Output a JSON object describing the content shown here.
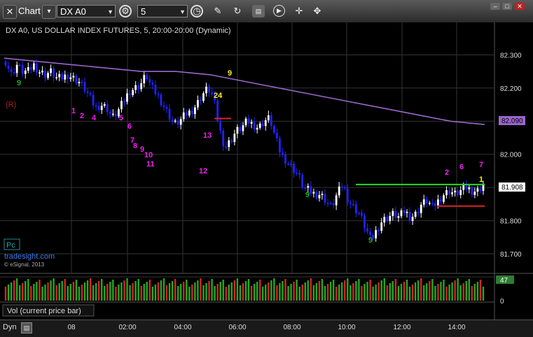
{
  "toolbar": {
    "chart_label": "Chart",
    "symbol": "DX A0",
    "interval": "5",
    "icons": [
      "pin-icon",
      "chart-icon",
      "dropdown-icon",
      "settings-icon",
      "clock-icon",
      "draw-icon",
      "refresh-icon",
      "study-icon",
      "play-icon",
      "move-icon"
    ]
  },
  "chart": {
    "title": "DX A0, US DOLLAR INDEX FUTURES, 5, 20:00-20:00 (Dynamic)",
    "r_marker": "(R)",
    "watermark_box": "Pc",
    "watermark_site": "tradesight.com",
    "watermark_copy": "© eSignal, 2013",
    "price_ticks": [
      "82.300",
      "82.200",
      "82.100",
      "82.000",
      "81.900",
      "81.800",
      "81.700"
    ],
    "ma_last_label": "82.090",
    "last_price_label": "81.908",
    "time_ticks": [
      "08",
      "02:00",
      "04:00",
      "06:00",
      "08:00",
      "10:00",
      "12:00",
      "14:00"
    ],
    "volume_label": "Vol (current price bar)",
    "volume_value": "47",
    "volume_zero": "0",
    "bottom_label": "Dyn"
  },
  "chart_data": {
    "type": "candlestick",
    "title": "DX A0, US DOLLAR INDEX FUTURES, 5, 20:00-20:00 (Dynamic)",
    "y_range": [
      81.66,
      82.36
    ],
    "y_ticks": [
      82.3,
      82.2,
      82.1,
      82.0,
      81.9,
      81.8,
      81.7
    ],
    "x_ticks": [
      "08",
      "02:00",
      "04:00",
      "06:00",
      "08:00",
      "10:00",
      "12:00",
      "14:00"
    ],
    "price_path": [
      82.28,
      82.24,
      82.27,
      82.25,
      82.25,
      82.27,
      82.25,
      82.24,
      82.25,
      82.23,
      82.23,
      82.24,
      82.23,
      82.22,
      82.2,
      82.17,
      82.14,
      82.15,
      82.14,
      82.11,
      82.13,
      82.16,
      82.19,
      82.2,
      82.21,
      82.24,
      82.2,
      82.18,
      82.15,
      82.12,
      82.09,
      82.1,
      82.12,
      82.13,
      82.15,
      82.18,
      82.2,
      82.17,
      82.08,
      82.02,
      82.04,
      82.07,
      82.08,
      82.1,
      82.09,
      82.08,
      82.1,
      82.11,
      82.05,
      82.0,
      81.98,
      81.96,
      81.94,
      81.9,
      81.89,
      81.88,
      81.88,
      81.86,
      81.84,
      81.88,
      81.91,
      81.86,
      81.84,
      81.82,
      81.78,
      81.74,
      81.77,
      81.8,
      81.81,
      81.82,
      81.81,
      81.83,
      81.81,
      81.82,
      81.85,
      81.86,
      81.84,
      81.86,
      81.88,
      81.89,
      81.88,
      81.89,
      81.9,
      81.89,
      81.89,
      81.91
    ],
    "ma_path": [
      82.29,
      82.28,
      82.27,
      82.26,
      82.25,
      82.25,
      82.24,
      82.22,
      82.2,
      82.18,
      82.16,
      82.14,
      82.12,
      82.1,
      82.09
    ],
    "support_lines": [
      {
        "value": 81.909,
        "color": "#22dd22"
      },
      {
        "value": 81.844,
        "color": "#dd2222"
      },
      {
        "value": 82.108,
        "color": "#dd2222"
      }
    ],
    "volume_last": 47,
    "colors": {
      "up_bar": "#ffffff",
      "down_bar": "#2222ff",
      "ma": "#9966cc",
      "grid": "#333333",
      "setup": "#ee22ee",
      "count": "#22aa22",
      "yellow": "#ffee22"
    },
    "annotations": [
      {
        "text": "(R)",
        "color": "#aa2222"
      },
      {
        "text": "1",
        "color": "#ee22ee"
      },
      {
        "text": "2",
        "color": "#ee22ee"
      },
      {
        "text": "4",
        "color": "#ee22ee"
      },
      {
        "text": "5",
        "color": "#ee22ee"
      },
      {
        "text": "6",
        "color": "#ee22ee"
      },
      {
        "text": "7",
        "color": "#ee22ee"
      },
      {
        "text": "8",
        "color": "#ee22ee"
      },
      {
        "text": "9",
        "color": "#ee22ee"
      },
      {
        "text": "10",
        "color": "#ee22ee"
      },
      {
        "text": "11",
        "color": "#ee22ee"
      },
      {
        "text": "12",
        "color": "#ee22ee"
      },
      {
        "text": "13",
        "color": "#ee22ee"
      },
      {
        "text": "9",
        "color": "#22aa22"
      },
      {
        "text": "9",
        "color": "#22aa22"
      },
      {
        "text": "9",
        "color": "#22aa22"
      },
      {
        "text": "9",
        "color": "#ffee22"
      },
      {
        "text": "24",
        "color": "#ffee22"
      },
      {
        "text": "7",
        "color": "#ee22ee"
      },
      {
        "text": "1",
        "color": "#ffee22"
      },
      {
        "text": "2",
        "color": "#ee22ee"
      },
      {
        "text": "6",
        "color": "#ee22ee"
      }
    ]
  }
}
